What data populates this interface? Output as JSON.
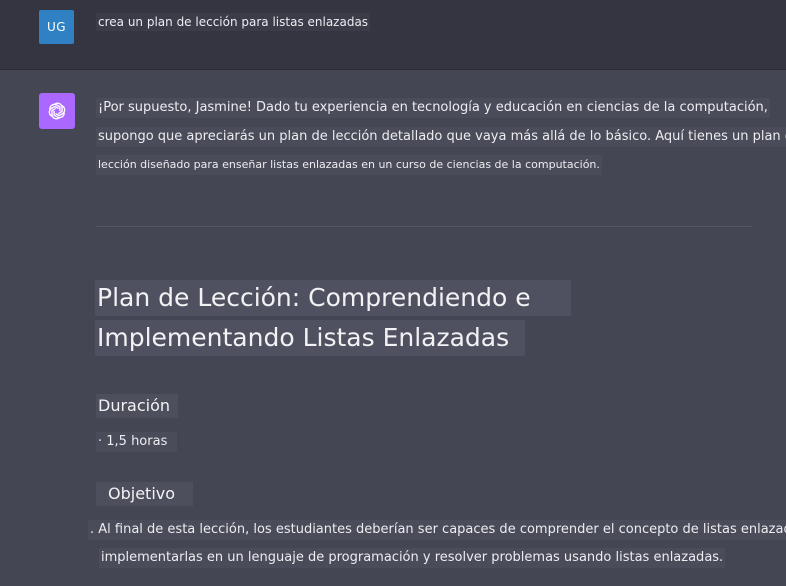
{
  "user_message": {
    "avatar_initials": "UG",
    "text": "crea un plan de lección para listas enlazadas"
  },
  "assistant_message": {
    "avatar_icon": "openai-logo-icon",
    "intro_lines": [
      "¡Por supuesto, Jasmine! Dado tu experiencia en tecnología y educación en ciencias de la computación,",
      "supongo que apreciarás un plan de lección detallado que vaya más allá de lo básico. Aquí tienes un plan de",
      "lección diseñado para enseñar listas enlazadas en un curso de ciencias de la computación."
    ],
    "title_lines": [
      "Plan de Lección: Comprendiendo e",
      "Implementando Listas Enlazadas"
    ],
    "duration_heading": "Duración",
    "duration_item": "· 1,5 horas",
    "objective_heading": "Objetivo",
    "objective_lines": [
      ". Al final de esta lección, los estudiantes deberían ser capaces de comprender el concepto de listas enlazadas,",
      "implementarlas en un lenguaje de programación y resolver problemas usando listas enlazadas."
    ]
  },
  "colors": {
    "user_bg": "#343541",
    "assistant_bg": "#444654",
    "user_avatar": "#2f81c4",
    "assistant_avatar": "#ab68ff"
  }
}
